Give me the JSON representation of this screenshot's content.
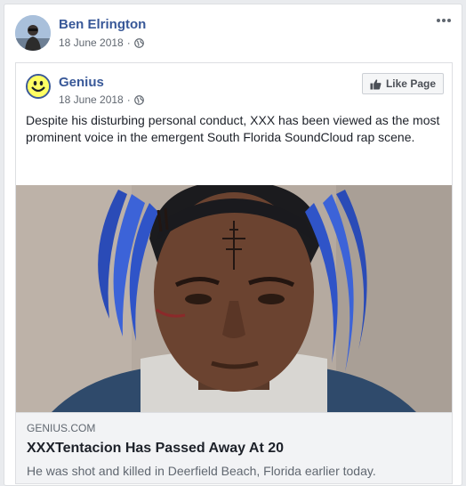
{
  "post": {
    "author": "Ben Elrington",
    "date": "18 June 2018",
    "separator": "·",
    "privacy_icon": "globe-icon",
    "menu_icon": "more-options-icon"
  },
  "shared": {
    "page_name": "Genius",
    "date": "18 June 2018",
    "separator": "·",
    "like_label": "Like Page",
    "text": "Despite his disturbing personal conduct, XXX has been viewed as the most prominent voice in the emergent South Florida SoundCloud rap scene.",
    "link": {
      "domain": "GENIUS.COM",
      "title": "XXXTentacion Has Passed Away At 20",
      "description": "He was shot and killed in Deerfield Beach, Florida earlier today."
    }
  },
  "colors": {
    "link_blue": "#385898",
    "text": "#1d2129",
    "secondary": "#606770",
    "logo_yellow": "#ffff64"
  }
}
